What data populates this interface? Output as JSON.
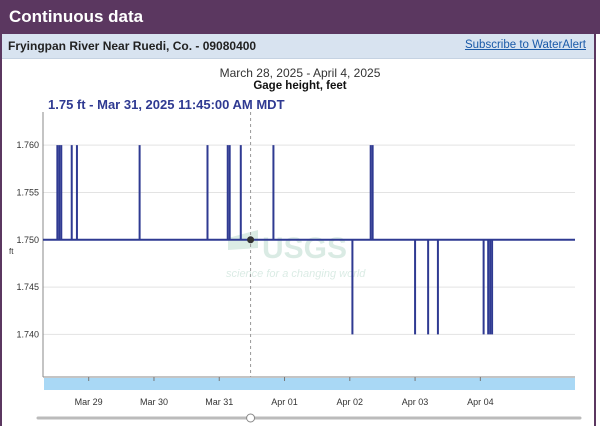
{
  "header": {
    "title": "Continuous data"
  },
  "site": {
    "name": "Fryingpan River Near Ruedi, Co. - 09080400",
    "subscribe_label": "Subscribe to WaterAlert"
  },
  "graph": {
    "date_range": "March 28, 2025 - April 4, 2025",
    "parameter": "Gage height, feet",
    "tooltip": "1.75 ft - Mar 31, 2025 11:45:00 AM MDT",
    "y_unit_label": "ft",
    "watermark_logo": "USGS",
    "watermark_tagline": "science for a changing world"
  },
  "colors": {
    "brand": "#5b3760",
    "series": "#2f3a92",
    "brush": "#a9d8f5"
  },
  "chart_data": {
    "type": "line",
    "xlabel": "",
    "ylabel": "ft",
    "xlim": [
      -0.7,
      7.45
    ],
    "ylim": [
      1.7355,
      1.7635
    ],
    "xticks": [
      {
        "x": 0,
        "label": "Mar 29"
      },
      {
        "x": 1,
        "label": "Mar 30"
      },
      {
        "x": 2,
        "label": "Mar 31"
      },
      {
        "x": 3,
        "label": "Apr 01"
      },
      {
        "x": 4,
        "label": "Apr 02"
      },
      {
        "x": 5,
        "label": "Apr 03"
      },
      {
        "x": 6,
        "label": "Apr 04"
      }
    ],
    "yticks": [
      1.74,
      1.745,
      1.75,
      1.755,
      1.76
    ],
    "grid": true,
    "series": [
      {
        "baseline": 1.75,
        "spikes": [
          {
            "x": -0.48,
            "y": 1.76
          },
          {
            "x": -0.45,
            "y": 1.76
          },
          {
            "x": -0.42,
            "y": 1.76
          },
          {
            "x": -0.26,
            "y": 1.76
          },
          {
            "x": -0.18,
            "y": 1.76
          },
          {
            "x": 0.78,
            "y": 1.76
          },
          {
            "x": 1.82,
            "y": 1.76
          },
          {
            "x": 2.13,
            "y": 1.76
          },
          {
            "x": 2.16,
            "y": 1.76
          },
          {
            "x": 2.33,
            "y": 1.76
          },
          {
            "x": 2.83,
            "y": 1.76
          },
          {
            "x": 4.32,
            "y": 1.76
          },
          {
            "x": 4.35,
            "y": 1.76
          },
          {
            "x": 4.04,
            "y": 1.74
          },
          {
            "x": 5.0,
            "y": 1.74
          },
          {
            "x": 5.2,
            "y": 1.74
          },
          {
            "x": 5.35,
            "y": 1.74
          },
          {
            "x": 6.05,
            "y": 1.74
          },
          {
            "x": 6.12,
            "y": 1.74
          },
          {
            "x": 6.15,
            "y": 1.74
          },
          {
            "x": 6.18,
            "y": 1.74
          }
        ]
      }
    ],
    "cursor": {
      "x": 2.48,
      "y": 1.75
    }
  }
}
